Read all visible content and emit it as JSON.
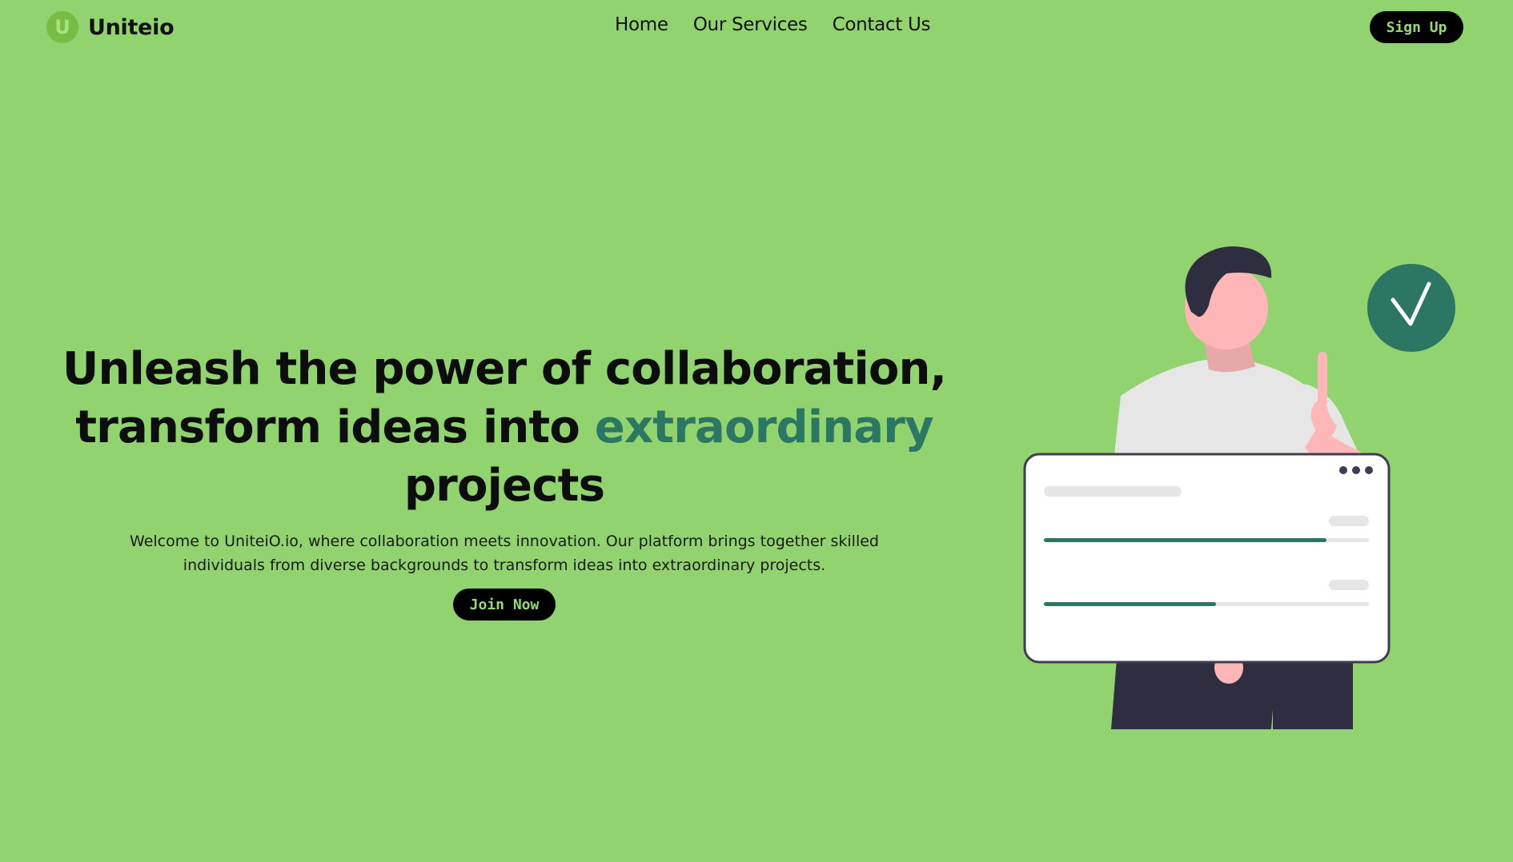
{
  "brand": {
    "logo_letter": "U",
    "name": "Uniteio"
  },
  "nav": {
    "links": [
      {
        "label": "Home"
      },
      {
        "label": "Our Services"
      },
      {
        "label": "Contact Us"
      }
    ]
  },
  "header": {
    "signup_label": "Sign Up"
  },
  "hero": {
    "title_part1": "Unleash the power of collaboration, transform ideas into ",
    "title_accent": "extraordinary",
    "title_part2": "projects",
    "description": "Welcome to UniteiO.io, where collaboration meets innovation. Our platform brings together skilled individuals from diverse backgrounds to transform ideas into extraordinary projects.",
    "join_label": "Join Now"
  },
  "illustration": {
    "progress_bars": [
      {
        "fraction": 0.87
      },
      {
        "fraction": 0.53
      }
    ]
  },
  "colors": {
    "background": "#91d36f",
    "accent": "#2b7763",
    "button_bg": "#000000",
    "button_text": "#93db6f",
    "check_circle": "#2b7763"
  },
  "icons": {
    "check": "checkmark-icon",
    "menu_dots": "more-dots-icon"
  }
}
